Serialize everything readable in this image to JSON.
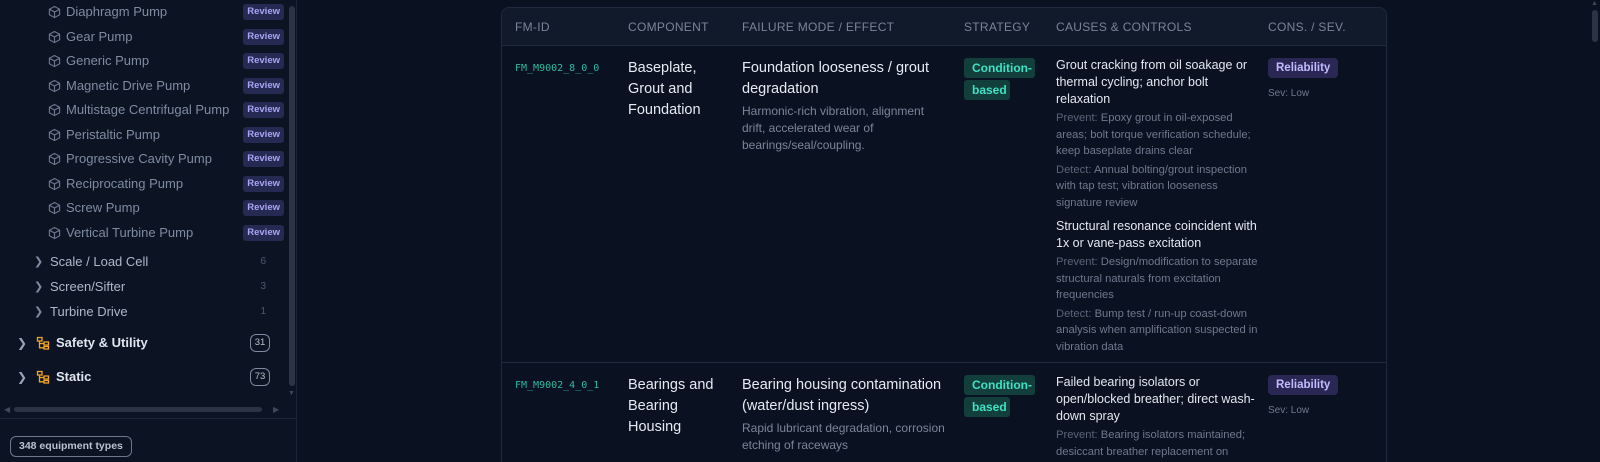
{
  "sidebar": {
    "pump_items": [
      {
        "label": "Diaphragm Pump",
        "badge": "Review"
      },
      {
        "label": "Gear Pump",
        "badge": "Review"
      },
      {
        "label": "Generic Pump",
        "badge": "Review"
      },
      {
        "label": "Magnetic Drive Pump",
        "badge": "Review"
      },
      {
        "label": "Multistage Centrifugal Pump",
        "badge": "Review"
      },
      {
        "label": "Peristaltic Pump",
        "badge": "Review"
      },
      {
        "label": "Progressive Cavity Pump",
        "badge": "Review"
      },
      {
        "label": "Reciprocating Pump",
        "badge": "Review"
      },
      {
        "label": "Screw Pump",
        "badge": "Review"
      },
      {
        "label": "Vertical Turbine Pump",
        "badge": "Review"
      }
    ],
    "categories": [
      {
        "label": "Scale / Load Cell",
        "count": "6"
      },
      {
        "label": "Screen/Sifter",
        "count": "3"
      },
      {
        "label": "Turbine Drive",
        "count": "1"
      }
    ],
    "groups": [
      {
        "label": "Safety & Utility",
        "count": "31"
      },
      {
        "label": "Static",
        "count": "73"
      }
    ],
    "footer_label": "348 equipment types",
    "icons": {
      "item": "cube-icon",
      "group": "hierarchy-icon",
      "chevron": "chevron-right-icon"
    },
    "colors": {
      "review_badge_bg": "#252a52",
      "review_badge_text": "#a9a4f3",
      "group_icon": "#f5a524"
    }
  },
  "table": {
    "headers": {
      "fm_id": "FM-ID",
      "component": "COMPONENT",
      "failure_mode": "FAILURE MODE / EFFECT",
      "strategy": "STRATEGY",
      "causes": "CAUSES & CONTROLS",
      "cons_sev": "CONS. / SEV."
    },
    "rows": [
      {
        "fm_id": "FM_M9002_8_0_0",
        "component": "Baseplate, Grout and Foundation",
        "failure_mode": "Foundation looseness / grout degradation",
        "effect": "Harmonic-rich vibration, alignment drift, accelerated wear of bearings/seal/coupling.",
        "strategy": "Condition-based",
        "causes": [
          {
            "title": "Grout cracking from oil soakage or thermal cycling; anchor bolt relaxation",
            "prevent_label": "Prevent:",
            "prevent": "Epoxy grout in oil-exposed areas; bolt torque verification schedule; keep baseplate drains clear",
            "detect_label": "Detect:",
            "detect": "Annual bolting/grout inspection with tap test; vibration looseness signature review"
          },
          {
            "title": "Structural resonance coincident with 1x or vane-pass excitation",
            "prevent_label": "Prevent:",
            "prevent": "Design/modification to separate structural naturals from excitation frequencies",
            "detect_label": "Detect:",
            "detect": "Bump test / run-up coast-down analysis when amplification suspected in vibration data"
          }
        ],
        "consequence": "Reliability",
        "severity": "Sev: Low"
      },
      {
        "fm_id": "FM_M9002_4_0_1",
        "component": "Bearings and Bearing Housing",
        "failure_mode": "Bearing housing contamination (water/dust ingress)",
        "effect": "Rapid lubricant degradation, corrosion etching of raceways",
        "strategy": "Condition-based",
        "causes": [
          {
            "title": "Failed bearing isolators or open/blocked breather; direct wash-down spray",
            "prevent_label": "Prevent:",
            "prevent": "Bearing isolators maintained; desiccant breather replacement on"
          }
        ],
        "consequence": "Reliability",
        "severity": "Sev: Low"
      }
    ],
    "colors": {
      "fm_id": "#2bbba0",
      "strategy_bg": "#123f3b",
      "strategy_text": "#3fe1c4",
      "consequence_bg": "#2a2755",
      "consequence_text": "#c4bbff"
    }
  }
}
